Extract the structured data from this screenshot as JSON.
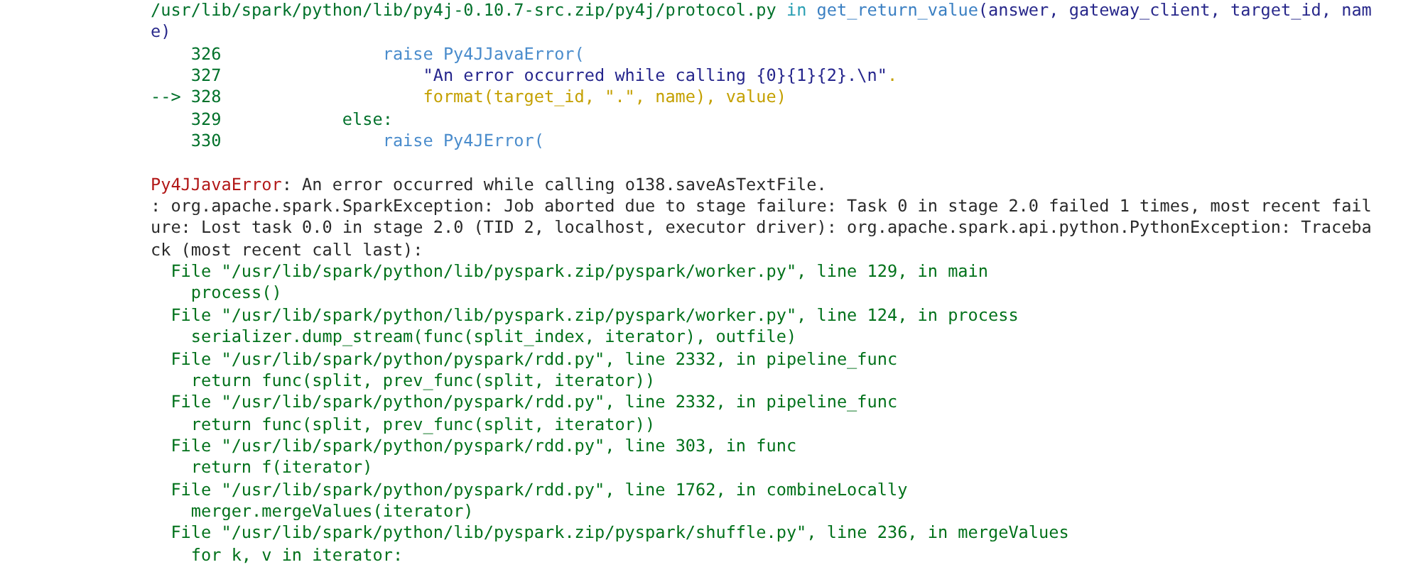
{
  "source": {
    "header": [
      {
        "segments": [
          {
            "kind": "path",
            "text": "/usr/lib/spark/python/lib/py4j-0.10.7-src.zip/py4j/protocol.py"
          },
          {
            "kind": "keyword",
            "text": " in "
          },
          {
            "kind": "func",
            "text": "get_return_value"
          },
          {
            "kind": "args",
            "text": "(answer, gateway_client, target_id, nam"
          }
        ]
      },
      {
        "segments": [
          {
            "kind": "args",
            "text": "e)"
          }
        ]
      }
    ],
    "lines": [
      {
        "number": "326",
        "segments": [
          {
            "kind": "call",
            "text": "                raise Py4JJavaError("
          }
        ]
      },
      {
        "number": "327",
        "segments": [
          {
            "kind": "string",
            "text": "                    \"An error occurred while calling {0}{1}{2}.\\n\""
          },
          {
            "kind": "attr",
            "text": "."
          }
        ]
      },
      {
        "marker": "-->",
        "number": "328",
        "segments": [
          {
            "kind": "attr",
            "text": "                    format(target_id, \".\", name), value)"
          }
        ]
      },
      {
        "number": "329",
        "segments": [
          {
            "kind": "keyword_green",
            "text": "            else:"
          }
        ]
      },
      {
        "number": "330",
        "segments": [
          {
            "kind": "call",
            "text": "                raise Py4JError("
          }
        ]
      }
    ]
  },
  "exception": {
    "lines": [
      {
        "segments": [
          {
            "kind": "ename",
            "text": "Py4JJavaError"
          },
          {
            "kind": "message",
            "text": ": An error occurred while calling o138.saveAsTextFile."
          }
        ]
      },
      {
        "segments": [
          {
            "kind": "message",
            "text": ": org.apache.spark.SparkException: Job aborted due to stage failure: Task 0 in stage 2.0 failed 1 times, most recent fail"
          }
        ]
      },
      {
        "segments": [
          {
            "kind": "message",
            "text": "ure: Lost task 0.0 in stage 2.0 (TID 2, localhost, executor driver): org.apache.spark.api.python.PythonException: Traceba"
          }
        ]
      },
      {
        "segments": [
          {
            "kind": "message",
            "text": "ck (most recent call last):"
          }
        ]
      },
      {
        "segments": [
          {
            "kind": "trace",
            "text": "  File \"/usr/lib/spark/python/lib/pyspark.zip/pyspark/worker.py\", line 129, in main"
          }
        ]
      },
      {
        "segments": [
          {
            "kind": "trace",
            "text": "    process()"
          }
        ]
      },
      {
        "segments": [
          {
            "kind": "trace",
            "text": "  File \"/usr/lib/spark/python/lib/pyspark.zip/pyspark/worker.py\", line 124, in process"
          }
        ]
      },
      {
        "segments": [
          {
            "kind": "trace",
            "text": "    serializer.dump_stream(func(split_index, iterator), outfile)"
          }
        ]
      },
      {
        "segments": [
          {
            "kind": "trace",
            "text": "  File \"/usr/lib/spark/python/pyspark/rdd.py\", line 2332, in pipeline_func"
          }
        ]
      },
      {
        "segments": [
          {
            "kind": "trace",
            "text": "    return func(split, prev_func(split, iterator))"
          }
        ]
      },
      {
        "segments": [
          {
            "kind": "trace",
            "text": "  File \"/usr/lib/spark/python/pyspark/rdd.py\", line 2332, in pipeline_func"
          }
        ]
      },
      {
        "segments": [
          {
            "kind": "trace",
            "text": "    return func(split, prev_func(split, iterator))"
          }
        ]
      },
      {
        "segments": [
          {
            "kind": "trace",
            "text": "  File \"/usr/lib/spark/python/pyspark/rdd.py\", line 303, in func"
          }
        ]
      },
      {
        "segments": [
          {
            "kind": "trace",
            "text": "    return f(iterator)"
          }
        ]
      },
      {
        "segments": [
          {
            "kind": "trace",
            "text": "  File \"/usr/lib/spark/python/pyspark/rdd.py\", line 1762, in combineLocally"
          }
        ]
      },
      {
        "segments": [
          {
            "kind": "trace",
            "text": "    merger.mergeValues(iterator)"
          }
        ]
      },
      {
        "segments": [
          {
            "kind": "trace",
            "text": "  File \"/usr/lib/spark/python/lib/pyspark.zip/pyspark/shuffle.py\", line 236, in mergeValues"
          }
        ]
      },
      {
        "segments": [
          {
            "kind": "trace",
            "text": "    for k, v in iterator:"
          }
        ]
      }
    ]
  }
}
